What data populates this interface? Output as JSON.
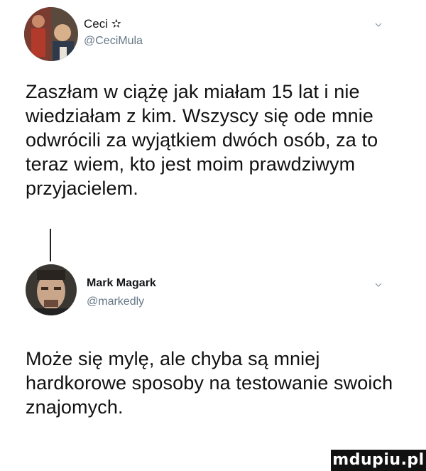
{
  "tweets": [
    {
      "author_name": "Ceci ✫",
      "author_handle": "@CeciMula",
      "text": "Zaszłam w ciążę jak miałam 15 lat i nie wiedziałam z kim. Wszyscy się ode mnie odwrócili za wyjątkiem dwóch osób, za to teraz wiem, kto jest moim prawdziwym przyjacielem."
    },
    {
      "author_name": "Mark Magark",
      "author_handle": "@markedly",
      "text": "Może się mylę, ale chyba są mniej hardkorowe sposoby na testowanie swoich znajomych."
    }
  ],
  "watermark": "mdupiu.pl",
  "icons": [
    "chevron-down-icon",
    "avatar-photo"
  ]
}
